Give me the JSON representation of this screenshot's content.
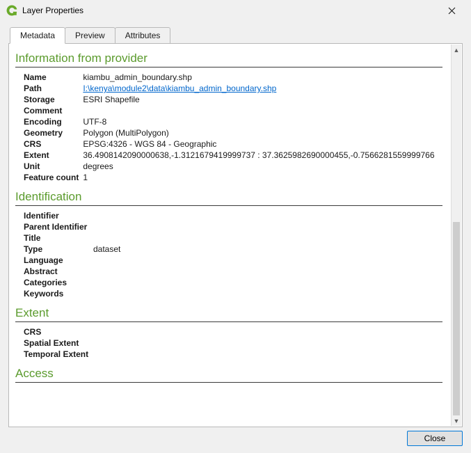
{
  "window": {
    "title": "Layer Properties"
  },
  "tabs": [
    {
      "label": "Metadata",
      "active": true
    },
    {
      "label": "Preview",
      "active": false
    },
    {
      "label": "Attributes",
      "active": false
    }
  ],
  "sections": {
    "provider": {
      "title": "Information from provider",
      "rows": {
        "name": {
          "label": "Name",
          "value": "kiambu_admin_boundary.shp"
        },
        "path": {
          "label": "Path",
          "value": "I:\\kenya\\module2\\data\\kiambu_admin_boundary.shp",
          "link": true
        },
        "storage": {
          "label": "Storage",
          "value": "ESRI Shapefile"
        },
        "comment": {
          "label": "Comment",
          "value": ""
        },
        "encoding": {
          "label": "Encoding",
          "value": "UTF-8"
        },
        "geometry": {
          "label": "Geometry",
          "value": "Polygon (MultiPolygon)"
        },
        "crs": {
          "label": "CRS",
          "value": "EPSG:4326 - WGS 84 - Geographic"
        },
        "extent": {
          "label": "Extent",
          "value": "36.4908142090000638,-1.3121679419999737 : 37.3625982690000455,-0.7566281559999766"
        },
        "unit": {
          "label": "Unit",
          "value": "degrees"
        },
        "feature_count": {
          "label": "Feature count",
          "value": "1"
        }
      }
    },
    "identification": {
      "title": "Identification",
      "rows": {
        "identifier": {
          "label": "Identifier",
          "value": ""
        },
        "parent_identifier": {
          "label": "Parent Identifier",
          "value": ""
        },
        "title": {
          "label": "Title",
          "value": ""
        },
        "type": {
          "label": "Type",
          "value": "dataset"
        },
        "language": {
          "label": "Language",
          "value": ""
        },
        "abstract": {
          "label": "Abstract",
          "value": ""
        },
        "categories": {
          "label": "Categories",
          "value": ""
        },
        "keywords": {
          "label": "Keywords",
          "value": ""
        }
      }
    },
    "extent": {
      "title": "Extent",
      "rows": {
        "crs": {
          "label": "CRS",
          "value": ""
        },
        "spatial_extent": {
          "label": "Spatial Extent",
          "value": ""
        },
        "temporal_extent": {
          "label": "Temporal Extent",
          "value": ""
        }
      }
    },
    "access": {
      "title": "Access"
    }
  },
  "buttons": {
    "close": "Close"
  }
}
